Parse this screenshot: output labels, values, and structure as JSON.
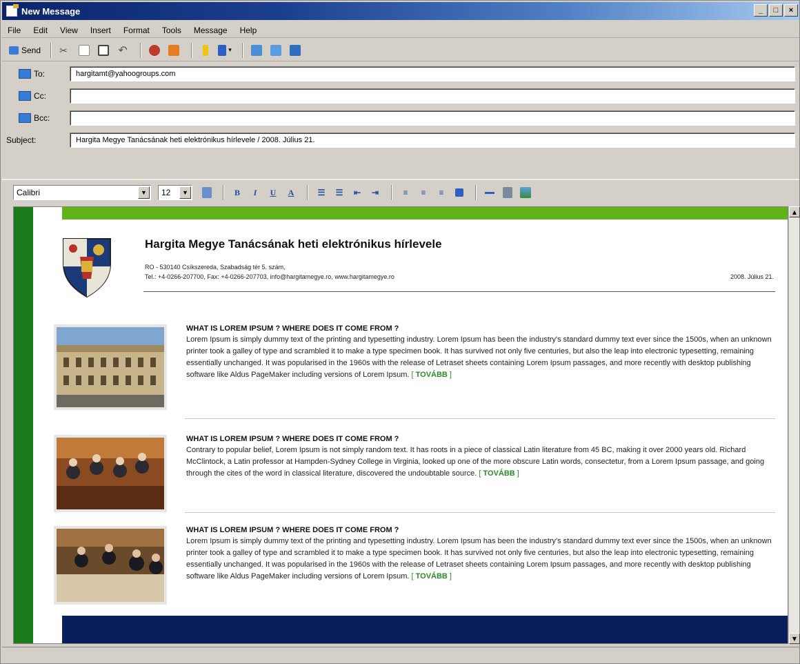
{
  "window": {
    "title": "New Message"
  },
  "menu": [
    "File",
    "Edit",
    "View",
    "Insert",
    "Format",
    "Tools",
    "Message",
    "Help"
  ],
  "toolbar": {
    "send_label": "Send"
  },
  "fields": {
    "to_label": "To:",
    "to_value": "hargitamt@yahoogroups.com",
    "cc_label": "Cc:",
    "cc_value": "",
    "bcc_label": "Bcc:",
    "bcc_value": "",
    "subject_label": "Subject:",
    "subject_value": "Hargita Megye Tanácsának heti elektrónikus hírlevele / 2008. Július 21."
  },
  "format": {
    "font": "Calibri",
    "size": "12"
  },
  "newsletter": {
    "title": "Hargita Megye Tanácsának heti elektrónikus hírlevele",
    "address1": "RO - 530140 Csíkszereda, Szabadság tér 5. szám,",
    "address2": "Tel.: +4-0266-207700, Fax: +4-0266-207703, info@hargitamegye.ro, www.hargitamegye.ro",
    "date": "2008. Július 21.",
    "more_label": "TOVÁBB",
    "articles": [
      {
        "heading": "WHAT IS LOREM IPSUM ? WHERE DOES IT COME FROM ?",
        "body": "Lorem Ipsum is simply dummy text of the printing and typesetting industry. Lorem Ipsum has been the industry's standard dummy text ever since the 1500s, when an unknown printer took a galley of type and scrambled it to make a type specimen book. It has survived not only five centuries, but also the leap into electronic typesetting, remaining essentially unchanged. It was popularised in the 1960s with the release of Letraset sheets containing Lorem Ipsum passages,  and more recently with desktop publishing software like Aldus PageMaker including versions of Lorem Ipsum."
      },
      {
        "heading": "WHAT IS LOREM IPSUM ? WHERE DOES IT COME FROM ?",
        "body": "Contrary to popular belief, Lorem Ipsum is not simply random text. It has roots in a piece of classical Latin literature from 45 BC, making it over 2000 years old. Richard McClintock, a Latin professor at Hampden-Sydney College in Virginia, looked up one of the more obscure Latin words, consectetur, from a Lorem Ipsum passage, and going through the cites of the word in classical literature, discovered the undoubtable source."
      },
      {
        "heading": "WHAT IS LOREM IPSUM ? WHERE DOES IT COME FROM ?",
        "body": "Lorem Ipsum is simply dummy text of the printing and typesetting industry. Lorem Ipsum has been the industry's standard dummy text ever since the 1500s, when an unknown printer took a galley of type and scrambled it to make a type specimen book. It has survived not only five centuries, but also the leap into electronic typesetting, remaining essentially unchanged. It was popularised in the 1960s with the release of Letraset sheets containing Lorem Ipsum passages,  and more recently with desktop publishing software like Aldus PageMaker including versions of Lorem Ipsum."
      }
    ]
  },
  "colors": {
    "accent_green": "#5fb41a",
    "sidebar_green": "#1b7a1b",
    "footer_navy": "#0b1e5c",
    "link_green": "#2a8a2a"
  }
}
